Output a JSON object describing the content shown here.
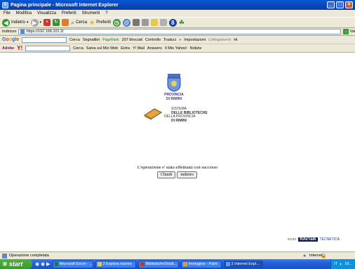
{
  "window": {
    "title": "Pagina principale - Microsoft Internet Explorer"
  },
  "menu": [
    "File",
    "Modifica",
    "Visualizza",
    "Preferiti",
    "Strumenti",
    "?"
  ],
  "toolbar": {
    "back": "Indietro",
    "search": "Cerca",
    "favorites": "Preferiti"
  },
  "address": {
    "label": "Indirizzo",
    "url": "https://192.168.101.3/",
    "go": "Vai"
  },
  "google": {
    "search_btn": "Cerca",
    "bookmarks": "Segnalibri",
    "pagerank": "PageRank",
    "blocked": "207 bloccati",
    "check": "Controllo",
    "translate": "Traduci",
    "more": "»",
    "settings": "Impostazioni",
    "links": "Collegamenti",
    "links_item": "Hi"
  },
  "yahoo": {
    "search_btn": "Cerca",
    "save_web": "Salva sul Mio Web",
    "extra": "Extra",
    "mail": "Y! Mail",
    "answers": "Answers",
    "my_yahoo": "Il Mio Yahoo!",
    "news": "Notizie"
  },
  "page": {
    "logo_line1": "PROVINCIA",
    "logo_line2": "DI RIMINI",
    "sys_line1": "SISTEMA",
    "sys_line2": "DELLE BIBLIOTECHE",
    "sys_line3": "DELLA PROVINCIA",
    "sys_line4": "DI RIMINI",
    "message": "L'operazione e' stata effettuata con successo",
    "close_btn": "Chiudi",
    "back_btn": "indietro",
    "footer_scuro": "scuro",
    "footer_logo": "RAvTalk",
    "footer_tecnica": "TECNETICA"
  },
  "status": {
    "text": "Operazione completata",
    "zone": "Internet"
  },
  "taskbar": {
    "start": "start",
    "tasks": [
      "Microsoft Excel - ...",
      "3 Esplora risorse",
      "BibliotecheStrutt...",
      "Immagine - Paint",
      "2 Internet Expl..."
    ],
    "lang": "IT",
    "clock": "16..."
  },
  "colors": {
    "xp_blue": "#0a58d8",
    "start_green": "#379b2b",
    "toolbar": "#ece9d8"
  }
}
